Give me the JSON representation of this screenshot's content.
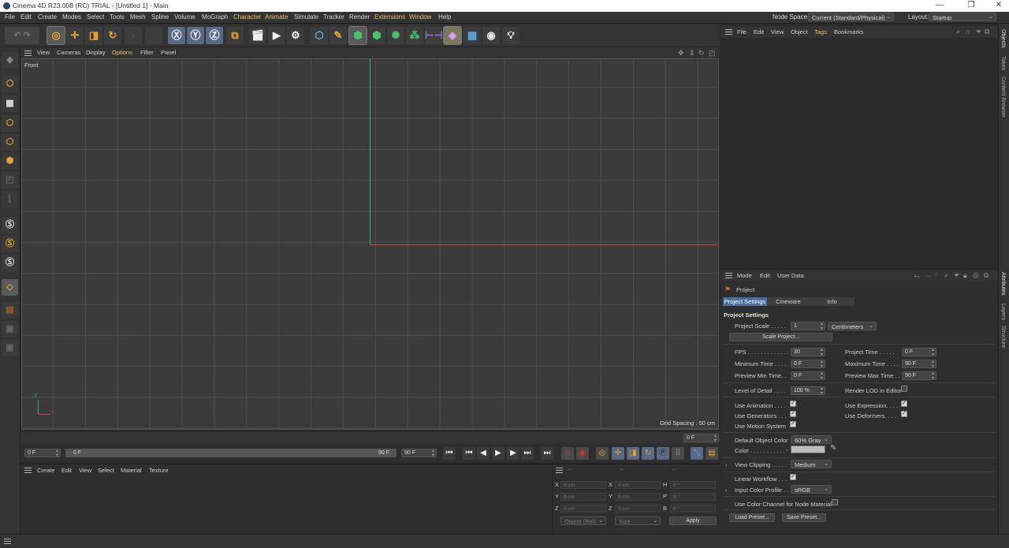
{
  "window": {
    "title": "Cinema 4D R23.008 (RC) TRIAL - [Untitled 1] - Main",
    "minimize": "—",
    "restore": "❐",
    "close": "✕"
  },
  "menubar": {
    "items": [
      "File",
      "Edit",
      "Create",
      "Modes",
      "Select",
      "Tools",
      "Mesh",
      "Spline",
      "Volume",
      "MoGraph",
      "Character",
      "Animate",
      "Simulate",
      "Tracker",
      "Render",
      "Extensions",
      "Window",
      "Help"
    ],
    "node_space_label": "Node Space:",
    "node_space_value": "Current (Standard/Physical)",
    "layout_label": "Layout:",
    "layout_value": "Startup"
  },
  "viewport": {
    "menu": [
      "View",
      "Cameras",
      "Display",
      "Options",
      "Filter",
      "Panel"
    ],
    "camera_label": "Front",
    "grid_spacing": "Grid Spacing : 50 cm",
    "axis_x_label": "x",
    "axis_y_label": "y",
    "axis_x_color": "#c0483a",
    "axis_y_color": "#3fae78"
  },
  "timeline": {
    "current_frame_right": "0 F",
    "start_field": "0 F",
    "slider_start": "0 F",
    "slider_end": "90 F",
    "end_field": "90 F"
  },
  "material_manager": {
    "menu": [
      "Create",
      "Edit",
      "View",
      "Select",
      "Material",
      "Texture"
    ]
  },
  "coordinates": {
    "header_dashes": [
      "--",
      "--",
      "--"
    ],
    "rows": [
      {
        "a": "X",
        "a_val": "0 cm",
        "b": "X",
        "b_val": "0 cm",
        "c": "H",
        "c_val": "0 °"
      },
      {
        "a": "Y",
        "a_val": "0 cm",
        "b": "Y",
        "b_val": "0 cm",
        "c": "P",
        "c_val": "0 °"
      },
      {
        "a": "Z",
        "a_val": "0 cm",
        "b": "Z",
        "b_val": "0 cm",
        "c": "B",
        "c_val": "0 °"
      }
    ],
    "mode_select": "Object (Rel)",
    "size_select": "Size",
    "apply": "Apply"
  },
  "object_manager": {
    "menu": [
      "File",
      "Edit",
      "View",
      "Object",
      "Tags",
      "Bookmarks"
    ]
  },
  "attributes": {
    "menu": [
      "Mode",
      "Edit",
      "User Data"
    ],
    "object_name": "Project",
    "tabs": [
      "Project Settings",
      "Cineware",
      "Info"
    ],
    "section_title": "Project Settings",
    "project_scale_label": "Project Scale . . . . .",
    "project_scale_value": "1",
    "project_scale_unit": "Centimeters",
    "scale_project_button": "Scale Project...",
    "fps_label": "FPS . . . . . . . . . . . . .",
    "fps_value": "30",
    "project_time_label": "Project Time . . . . .",
    "project_time_value": "0 F",
    "min_time_label": "Minimum Time . . . .",
    "min_time_value": "0 F",
    "max_time_label": "Maximum Time . . . .",
    "max_time_value": "90 F",
    "preview_min_label": "Preview Min Time. .",
    "preview_min_value": "0 F",
    "preview_max_label": "Preview Max Time . .",
    "preview_max_value": "90 F",
    "lod_label": "Level of Detail . . . .",
    "lod_value": "100 %",
    "render_lod_label": "Render LOD in Editor",
    "use_animation_label": "Use Animation . . . .",
    "use_expression_label": "Use Expression. . . .",
    "use_generators_label": "Use Generators . . .",
    "use_deformers_label": "Use Deformers. . . .",
    "use_motion_label": "Use Motion System",
    "default_color_label": "Default Object Color",
    "default_color_value": "60% Gray",
    "color_label": "Color . . . . . . . . . . .",
    "color_swatch": "#bdbdbd",
    "view_clipping_label": "View Clipping . . . . .",
    "view_clipping_value": "Medium",
    "linear_workflow_label": "Linear Workflow . . .",
    "input_profile_label": "Input Color Profile . .",
    "input_profile_value": "sRGB",
    "node_channel_label": "Use Color Channel for Node Material",
    "load_preset": "Load Preset...",
    "save_preset": "Save Preset..."
  },
  "right_tabs": {
    "top": [
      "Objects",
      "Takes",
      "Content Browser"
    ],
    "bottom": [
      "Attributes",
      "Layers",
      "Structure"
    ]
  },
  "colors": {
    "accent_blue": "#4a6ea0",
    "highlight_menu": "#e8c46b"
  }
}
